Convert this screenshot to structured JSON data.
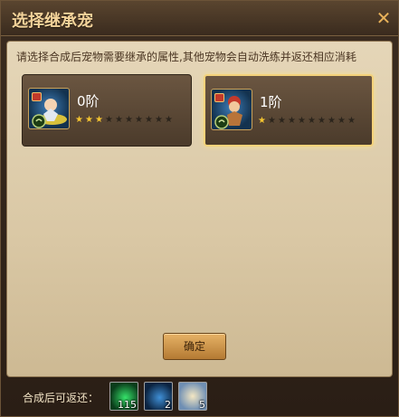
{
  "window": {
    "title": "选择继承宠"
  },
  "instruction": "请选择合成后宠物需要继承的属性,其他宠物会自动洗练并返还相应消耗",
  "pets": [
    {
      "tier_label": "0阶",
      "stars_filled": 3,
      "stars_total": 10,
      "selected": false,
      "icon": "pet-portrait-blue-icon"
    },
    {
      "tier_label": "1阶",
      "stars_filled": 1,
      "stars_total": 10,
      "selected": true,
      "icon": "pet-portrait-red-icon"
    }
  ],
  "confirm_label": "确定",
  "returns": {
    "label": "合成后可返还：",
    "items": [
      {
        "icon": "green-crystal-icon",
        "count": "115"
      },
      {
        "icon": "green-orb-icon",
        "count": "2"
      },
      {
        "icon": "scroll-icon",
        "count": "5"
      }
    ]
  },
  "colors": {
    "star_on": "#f4c430",
    "selected_border": "#f4d27a"
  }
}
